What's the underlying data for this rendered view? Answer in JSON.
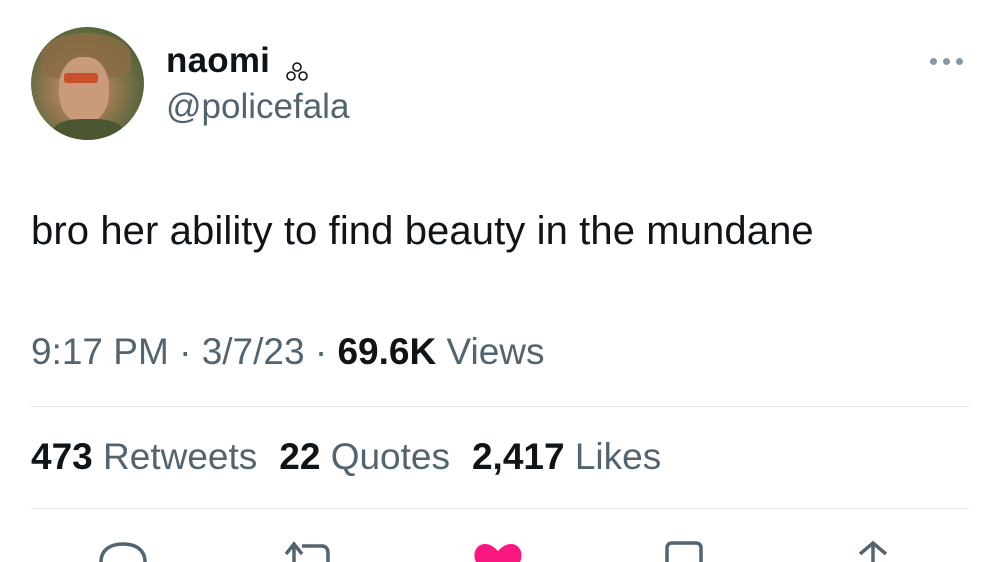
{
  "tweet": {
    "author_name": "naomi",
    "author_handle": "@policefala",
    "text": "bro her ability to find beauty in the mundane",
    "time": "9:17 PM",
    "date": "3/7/23",
    "views_count": "69.6K",
    "views_label": "Views",
    "separator": "·"
  },
  "stats": {
    "retweets_count": "473",
    "retweets_label": "Retweets",
    "quotes_count": "22",
    "quotes_label": "Quotes",
    "likes_count": "2,417",
    "likes_label": "Likes"
  },
  "icons": {
    "badge": "three-circles-icon",
    "more": "more-options-icon",
    "reply": "reply-icon",
    "retweet": "retweet-icon",
    "like": "heart-icon",
    "bookmark": "bookmark-icon",
    "share": "share-icon"
  },
  "colors": {
    "text": "#0f1419",
    "secondary": "#536471",
    "like": "#f91880",
    "divider": "#e3e6e8"
  }
}
